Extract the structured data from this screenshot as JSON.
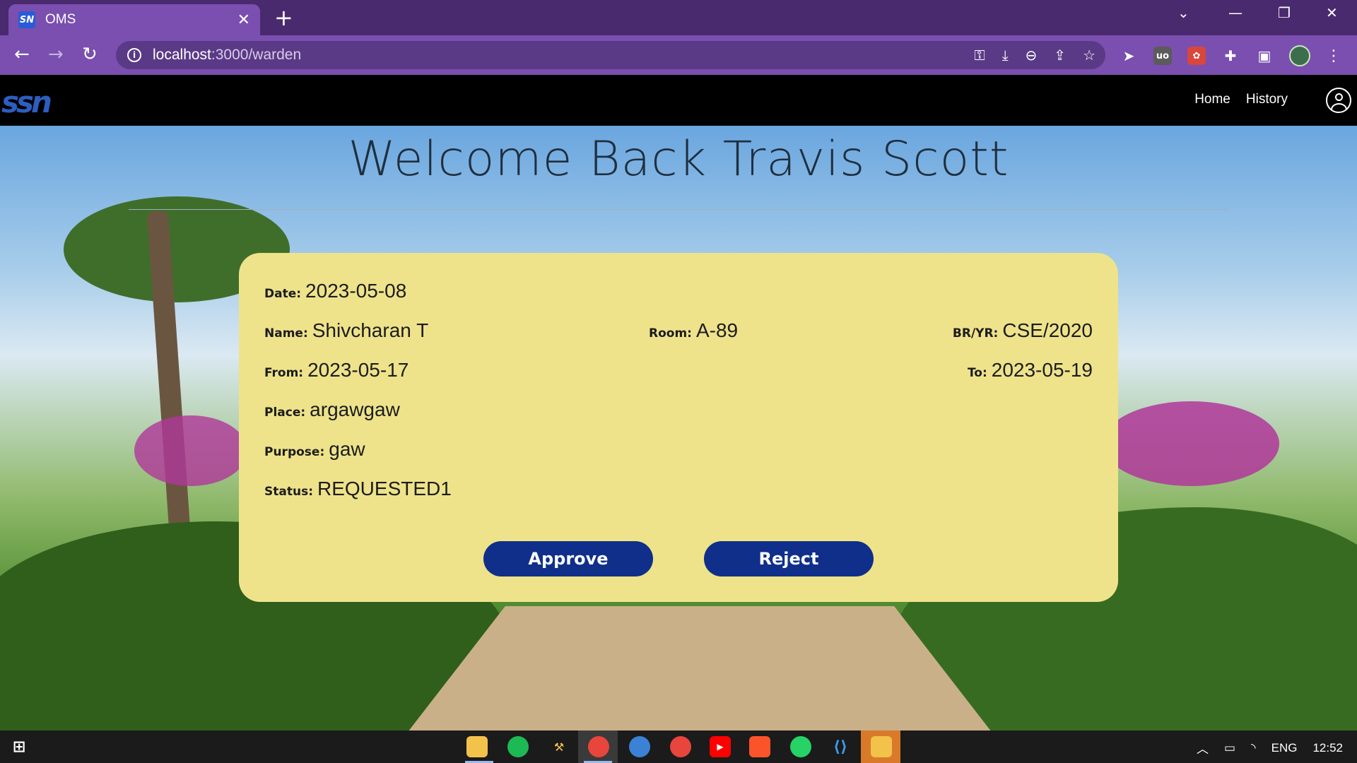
{
  "browser": {
    "tab_title": "OMS",
    "url_host": "localhost",
    "url_path": ":3000/warden"
  },
  "app": {
    "logo_text": "ssn",
    "nav": {
      "home": "Home",
      "history": "History"
    },
    "welcome": "Welcome Back Travis Scott"
  },
  "request": {
    "date_label": "Date:",
    "date": "2023-05-08",
    "name_label": "Name:",
    "name": "Shivcharan T",
    "room_label": "Room:",
    "room": "A-89",
    "bryr_label": "BR/YR:",
    "bryr": "CSE/2020",
    "from_label": "From:",
    "from": "2023-05-17",
    "to_label": "To:",
    "to": "2023-05-19",
    "place_label": "Place:",
    "place": "argawgaw",
    "purpose_label": "Purpose:",
    "purpose": "gaw",
    "status_label": "Status:",
    "status": "REQUESTED1",
    "approve": "Approve",
    "reject": "Reject"
  },
  "taskbar": {
    "lang": "ENG",
    "time": "12:52"
  },
  "colors": {
    "card_bg": "#eee38b",
    "button_bg": "#0f2f8a",
    "chrome_tab": "#7a4fb0",
    "chrome_frame": "#4a2a6e"
  }
}
